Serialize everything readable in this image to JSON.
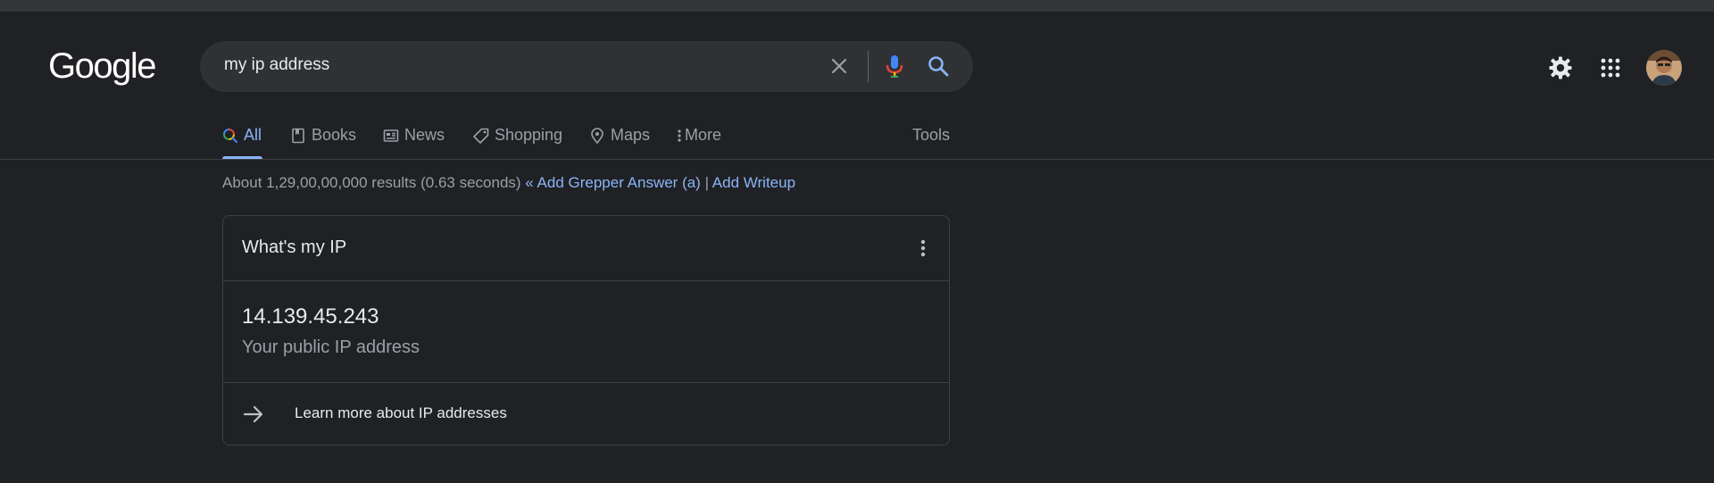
{
  "logo": "Google",
  "search": {
    "query": "my ip address"
  },
  "tabs": [
    {
      "label": "All",
      "icon": "search-icon",
      "active": true
    },
    {
      "label": "Books",
      "icon": "book-icon"
    },
    {
      "label": "News",
      "icon": "news-icon"
    },
    {
      "label": "Shopping",
      "icon": "tag-icon"
    },
    {
      "label": "Maps",
      "icon": "map-pin-icon"
    },
    {
      "label": "More",
      "icon": "more-vert-icon"
    }
  ],
  "tools_label": "Tools",
  "stats": {
    "text": "About 1,29,00,00,000 results (0.63 seconds)",
    "link1": "« Add Grepper Answer (a)",
    "separator": "|",
    "link2": "Add Writeup"
  },
  "card": {
    "title": "What's my IP",
    "ip": "14.139.45.243",
    "subtitle": "Your public IP address",
    "learn_more": "Learn more about IP addresses"
  },
  "colors": {
    "background": "#202124",
    "accent": "#8ab4f8",
    "searchbox": "#303134"
  }
}
